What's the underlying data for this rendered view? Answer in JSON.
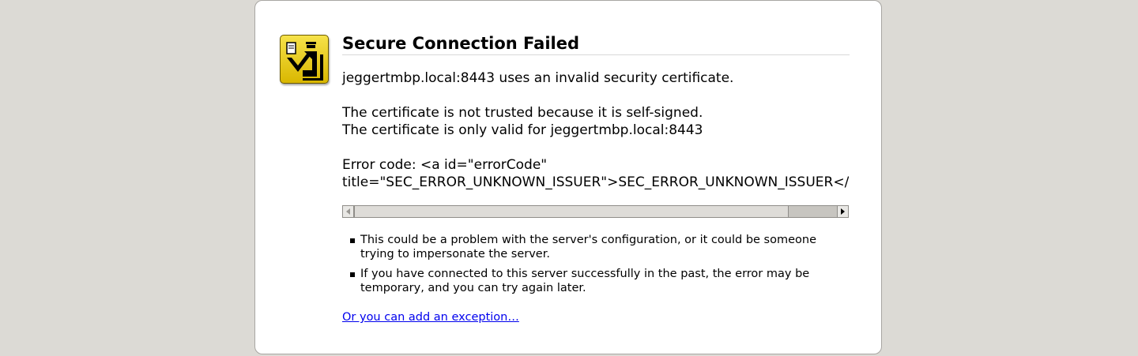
{
  "error": {
    "title": "Secure Connection Failed",
    "intro": "jeggertmbp.local:8443 uses an invalid security certificate.",
    "reasons": [
      "The certificate is not trusted because it is self-signed.",
      "The certificate is only valid for jeggertmbp.local:8443"
    ],
    "code_line1": "Error code: <a id=\"errorCode\"",
    "code_line2": "title=\"SEC_ERROR_UNKNOWN_ISSUER\">SEC_ERROR_UNKNOWN_ISSUER</a>",
    "bullets": [
      "This could be a problem with the server's configuration, or it could be someone trying to impersonate the server.",
      "If you have connected to this server successfully in the past, the error may be temporary, and you can try again later."
    ],
    "exception_link": "Or you can add an exception…"
  },
  "icons": {
    "warning": "security-officer-icon",
    "scroll_left": "arrow-left-icon",
    "scroll_right": "arrow-right-icon"
  },
  "colors": {
    "page_background": "#dcdad5",
    "container_background": "#ffffff",
    "icon_yellow": "#e8cc1c",
    "link": "#0000ee"
  }
}
